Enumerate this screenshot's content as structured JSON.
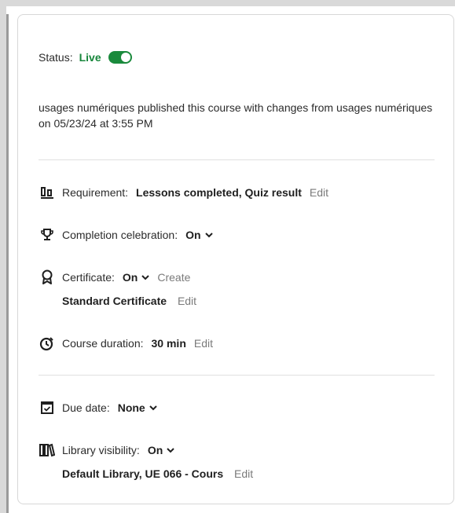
{
  "status": {
    "label": "Status:",
    "value": "Live",
    "toggle_on": true
  },
  "publish_note": "usages numériques published this course with changes from usages numériques on 05/23/24 at 3:55 PM",
  "requirement": {
    "label": "Requirement:",
    "value": "Lessons completed, Quiz result",
    "edit": "Edit",
    "icon": "bar-chart-icon"
  },
  "celebration": {
    "label": "Completion celebration:",
    "value": "On",
    "icon": "trophy-icon"
  },
  "certificate": {
    "label": "Certificate:",
    "value": "On",
    "create": "Create",
    "name": "Standard Certificate",
    "edit": "Edit",
    "icon": "award-ribbon-icon"
  },
  "duration": {
    "label": "Course duration:",
    "value": "30 min",
    "edit": "Edit",
    "icon": "stopwatch-icon"
  },
  "due_date": {
    "label": "Due date:",
    "value": "None",
    "icon": "calendar-check-icon"
  },
  "library": {
    "label": "Library visibility:",
    "value": "On",
    "libraries": "Default Library, UE 066 - Cours",
    "edit": "Edit",
    "icon": "library-books-icon"
  },
  "colors": {
    "live_green": "#17863b",
    "toggle_green": "#1a8a3c",
    "edit_gray": "#7a7a7a"
  }
}
